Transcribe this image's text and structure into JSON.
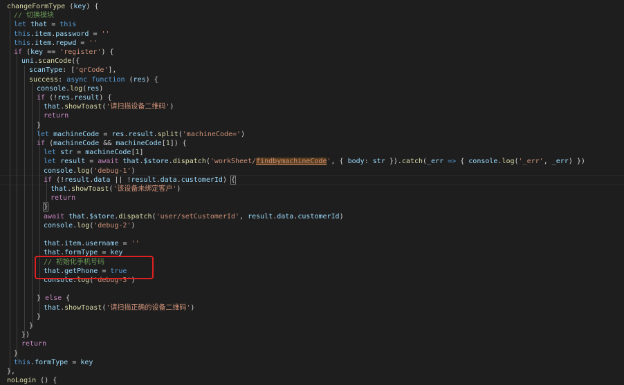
{
  "editor": {
    "lines": [
      {
        "segs": [
          [
            "fn",
            "changeFormType"
          ],
          [
            "pun",
            " ("
          ],
          [
            "var",
            "key"
          ],
          [
            "pun",
            ") {"
          ]
        ]
      },
      {
        "segs": [
          [
            "cm",
            "// 切换模块"
          ]
        ]
      },
      {
        "segs": [
          [
            "kw",
            "let "
          ],
          [
            "var",
            "that"
          ],
          [
            "pun",
            " = "
          ],
          [
            "kw",
            "this"
          ]
        ]
      },
      {
        "segs": [
          [
            "kw",
            "this"
          ],
          [
            "pun",
            "."
          ],
          [
            "var",
            "item"
          ],
          [
            "pun",
            "."
          ],
          [
            "var",
            "password"
          ],
          [
            "pun",
            " = "
          ],
          [
            "str",
            "''"
          ]
        ]
      },
      {
        "segs": [
          [
            "kw",
            "this"
          ],
          [
            "pun",
            "."
          ],
          [
            "var",
            "item"
          ],
          [
            "pun",
            "."
          ],
          [
            "var",
            "repwd"
          ],
          [
            "pun",
            " = "
          ],
          [
            "str",
            "''"
          ]
        ]
      },
      {
        "segs": [
          [
            "ctl",
            "if"
          ],
          [
            "pun",
            " ("
          ],
          [
            "var",
            "key"
          ],
          [
            "pun",
            " == "
          ],
          [
            "str",
            "'register'"
          ],
          [
            "pun",
            ") {"
          ]
        ]
      },
      {
        "segs": [
          [
            "var",
            "uni"
          ],
          [
            "pun",
            "."
          ],
          [
            "fn",
            "scanCode"
          ],
          [
            "pun",
            "({"
          ]
        ]
      },
      {
        "segs": [
          [
            "var",
            "scanType"
          ],
          [
            "pun",
            ": ["
          ],
          [
            "str",
            "'qrCode'"
          ],
          [
            "pun",
            "],"
          ]
        ]
      },
      {
        "segs": [
          [
            "fn",
            "success"
          ],
          [
            "pun",
            ": "
          ],
          [
            "kw",
            "async function"
          ],
          [
            "pun",
            " ("
          ],
          [
            "var",
            "res"
          ],
          [
            "pun",
            ") {"
          ]
        ]
      },
      {
        "segs": [
          [
            "var",
            "console"
          ],
          [
            "pun",
            "."
          ],
          [
            "fn",
            "log"
          ],
          [
            "pun",
            "("
          ],
          [
            "var",
            "res"
          ],
          [
            "pun",
            ")"
          ]
        ]
      },
      {
        "segs": [
          [
            "ctl",
            "if"
          ],
          [
            "pun",
            " (!"
          ],
          [
            "var",
            "res"
          ],
          [
            "pun",
            "."
          ],
          [
            "var",
            "result"
          ],
          [
            "pun",
            ") {"
          ]
        ]
      },
      {
        "segs": [
          [
            "var",
            "that"
          ],
          [
            "pun",
            "."
          ],
          [
            "fn",
            "showToast"
          ],
          [
            "pun",
            "("
          ],
          [
            "str",
            "'请扫描设备二维码'"
          ],
          [
            "pun",
            ")"
          ]
        ]
      },
      {
        "segs": [
          [
            "ctl",
            "return"
          ]
        ]
      },
      {
        "segs": [
          [
            "pun",
            "}"
          ]
        ]
      },
      {
        "segs": [
          [
            "kw",
            "let "
          ],
          [
            "var",
            "machineCode"
          ],
          [
            "pun",
            " = "
          ],
          [
            "var",
            "res"
          ],
          [
            "pun",
            "."
          ],
          [
            "var",
            "result"
          ],
          [
            "pun",
            "."
          ],
          [
            "fn",
            "split"
          ],
          [
            "pun",
            "("
          ],
          [
            "str",
            "'machineCode='"
          ],
          [
            "pun",
            ")"
          ]
        ]
      },
      {
        "segs": [
          [
            "ctl",
            "if"
          ],
          [
            "pun",
            " ("
          ],
          [
            "var",
            "machineCode"
          ],
          [
            "pun",
            " && "
          ],
          [
            "var",
            "machineCode"
          ],
          [
            "pun",
            "["
          ],
          [
            "num",
            "1"
          ],
          [
            "pun",
            "]) {"
          ]
        ]
      },
      {
        "segs": [
          [
            "kw",
            "let "
          ],
          [
            "var",
            "str"
          ],
          [
            "pun",
            " = "
          ],
          [
            "var",
            "machineCode"
          ],
          [
            "pun",
            "["
          ],
          [
            "num",
            "1"
          ],
          [
            "pun",
            "]"
          ]
        ]
      },
      {
        "segs": [
          [
            "kw",
            "let "
          ],
          [
            "var",
            "result"
          ],
          [
            "pun",
            " = "
          ],
          [
            "ctl",
            "await "
          ],
          [
            "var",
            "that"
          ],
          [
            "pun",
            "."
          ],
          [
            "var",
            "$store"
          ],
          [
            "pun",
            "."
          ],
          [
            "fn",
            "dispatch"
          ],
          [
            "pun",
            "("
          ],
          [
            "str",
            "'workSheet/"
          ],
          [
            "str-hl",
            "findbymachineCode"
          ],
          [
            "str",
            "'"
          ],
          [
            "pun",
            ", { "
          ],
          [
            "var",
            "body"
          ],
          [
            "pun",
            ": "
          ],
          [
            "var",
            "str"
          ],
          [
            "pun",
            " })."
          ],
          [
            "fn",
            "catch"
          ],
          [
            "pun",
            "("
          ],
          [
            "var",
            "_err"
          ],
          [
            "kw",
            " => "
          ],
          [
            "pun",
            "{ "
          ],
          [
            "var",
            "console"
          ],
          [
            "pun",
            "."
          ],
          [
            "fn",
            "log"
          ],
          [
            "pun",
            "("
          ],
          [
            "str",
            "'_err'"
          ],
          [
            "pun",
            ", "
          ],
          [
            "var",
            "_err"
          ],
          [
            "pun",
            ") })"
          ]
        ]
      },
      {
        "segs": [
          [
            "var",
            "console"
          ],
          [
            "pun",
            "."
          ],
          [
            "fn",
            "log"
          ],
          [
            "pun",
            "("
          ],
          [
            "str",
            "'debug-1'"
          ],
          [
            "pun",
            ")"
          ]
        ]
      },
      {
        "segs": [
          [
            "ctl",
            "if"
          ],
          [
            "pun",
            " (!"
          ],
          [
            "var",
            "result"
          ],
          [
            "pun",
            "."
          ],
          [
            "var",
            "data"
          ],
          [
            "pun",
            " || !"
          ],
          [
            "var",
            "result"
          ],
          [
            "pun",
            "."
          ],
          [
            "var",
            "data"
          ],
          [
            "pun",
            "."
          ],
          [
            "var",
            "customerId"
          ],
          [
            "pun",
            ") "
          ],
          [
            "box",
            "{"
          ]
        ]
      },
      {
        "segs": [
          [
            "var",
            "that"
          ],
          [
            "pun",
            "."
          ],
          [
            "fn",
            "showToast"
          ],
          [
            "pun",
            "("
          ],
          [
            "str",
            "'该设备未绑定客户'"
          ],
          [
            "pun",
            ")"
          ]
        ]
      },
      {
        "segs": [
          [
            "ctl",
            "return"
          ]
        ]
      },
      {
        "segs": [
          [
            "box",
            "}"
          ]
        ]
      },
      {
        "segs": [
          [
            "ctl",
            "await "
          ],
          [
            "var",
            "that"
          ],
          [
            "pun",
            "."
          ],
          [
            "var",
            "$store"
          ],
          [
            "pun",
            "."
          ],
          [
            "fn",
            "dispatch"
          ],
          [
            "pun",
            "("
          ],
          [
            "str",
            "'user/setCustomerId'"
          ],
          [
            "pun",
            ", "
          ],
          [
            "var",
            "result"
          ],
          [
            "pun",
            "."
          ],
          [
            "var",
            "data"
          ],
          [
            "pun",
            "."
          ],
          [
            "var",
            "customerId"
          ],
          [
            "pun",
            ")"
          ]
        ]
      },
      {
        "segs": [
          [
            "var",
            "console"
          ],
          [
            "pun",
            "."
          ],
          [
            "fn",
            "log"
          ],
          [
            "pun",
            "("
          ],
          [
            "str",
            "'debug-2'"
          ],
          [
            "pun",
            ")"
          ]
        ]
      },
      {
        "segs": []
      },
      {
        "segs": [
          [
            "var",
            "that"
          ],
          [
            "pun",
            "."
          ],
          [
            "var",
            "item"
          ],
          [
            "pun",
            "."
          ],
          [
            "var",
            "username"
          ],
          [
            "pun",
            " = "
          ],
          [
            "str",
            "''"
          ]
        ]
      },
      {
        "segs": [
          [
            "var",
            "that"
          ],
          [
            "pun",
            "."
          ],
          [
            "var",
            "formType"
          ],
          [
            "pun",
            " = "
          ],
          [
            "var",
            "key"
          ]
        ]
      },
      {
        "segs": [
          [
            "cm",
            "// 初始化手机号码"
          ]
        ]
      },
      {
        "segs": [
          [
            "var",
            "that"
          ],
          [
            "pun",
            "."
          ],
          [
            "var",
            "getPhone"
          ],
          [
            "pun",
            " = "
          ],
          [
            "kw",
            "true"
          ]
        ]
      },
      {
        "segs": [
          [
            "var",
            "console"
          ],
          [
            "pun",
            "."
          ],
          [
            "fn",
            "log"
          ],
          [
            "pun",
            "("
          ],
          [
            "str",
            "'debug-3'"
          ],
          [
            "pun",
            ")"
          ]
        ]
      },
      {
        "segs": []
      },
      {
        "segs": [
          [
            "pun",
            "} "
          ],
          [
            "ctl",
            "else"
          ],
          [
            "pun",
            " {"
          ]
        ]
      },
      {
        "segs": [
          [
            "var",
            "that"
          ],
          [
            "pun",
            "."
          ],
          [
            "fn",
            "showToast"
          ],
          [
            "pun",
            "("
          ],
          [
            "str",
            "'请扫描正确的设备二维码'"
          ],
          [
            "pun",
            ")"
          ]
        ]
      },
      {
        "segs": [
          [
            "pun",
            "}"
          ]
        ]
      },
      {
        "segs": [
          [
            "pun",
            "}"
          ]
        ]
      },
      {
        "segs": [
          [
            "pun",
            "})"
          ]
        ]
      },
      {
        "segs": [
          [
            "ctl",
            "return"
          ]
        ]
      },
      {
        "segs": [
          [
            "pun",
            "}"
          ]
        ]
      },
      {
        "segs": [
          [
            "kw",
            "this"
          ],
          [
            "pun",
            "."
          ],
          [
            "var",
            "formType"
          ],
          [
            "pun",
            " = "
          ],
          [
            "var",
            "key"
          ]
        ]
      },
      {
        "segs": [
          [
            "pun",
            "},"
          ]
        ]
      },
      {
        "segs": [
          [
            "fn",
            "noLogin"
          ],
          [
            "pun",
            " () {"
          ]
        ]
      }
    ]
  }
}
